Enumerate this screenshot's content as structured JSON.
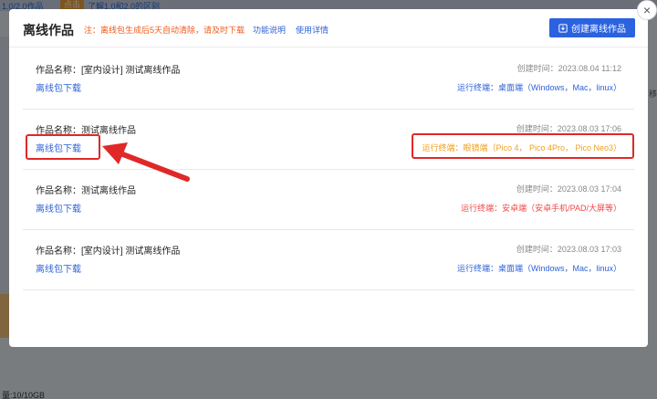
{
  "background": {
    "top_left": "1.0/2.0作品",
    "top_pill": "点击",
    "top_mid": "了解1.0和2.0的区别",
    "right_text": "移",
    "bottom_text": "量:10/10GB"
  },
  "modal": {
    "title": "离线作品",
    "notice": "注：离线包生成后5天自动清除，请及时下载",
    "link_func": "功能说明",
    "link_usage": "使用详情",
    "create_button": "创建离线作品"
  },
  "items": [
    {
      "name": "作品名称：[室内设计] 测试离线作品",
      "download": "离线包下载",
      "time": "创建时间：2023.08.04 11:12",
      "terminal": "运行终端：桌面端（Windows，Mac，linux）",
      "terminal_color": "#2d62d8"
    },
    {
      "name": "作品名称：测试离线作品",
      "download": "离线包下载",
      "time": "创建时间：2023.08.03 17:06",
      "terminal": "运行终端：眼镜端（Pico 4， Pico 4Pro， Pico Neo3）",
      "terminal_color": "#f0a020"
    },
    {
      "name": "作品名称：测试离线作品",
      "download": "离线包下载",
      "time": "创建时间：2023.08.03 17:04",
      "terminal": "运行终端：安卓端（安卓手机/PAD/大屏等）",
      "terminal_color": "#f04848"
    },
    {
      "name": "作品名称：[室内设计] 测试离线作品",
      "download": "离线包下载",
      "time": "创建时间：2023.08.03 17:03",
      "terminal": "运行终端：桌面端（Windows，Mac，linux）",
      "terminal_color": "#2d62d8"
    }
  ],
  "close_label": "×",
  "icons": {
    "create": "download-box-icon",
    "close": "close-icon",
    "arrow": "red-arrow-annotation"
  }
}
